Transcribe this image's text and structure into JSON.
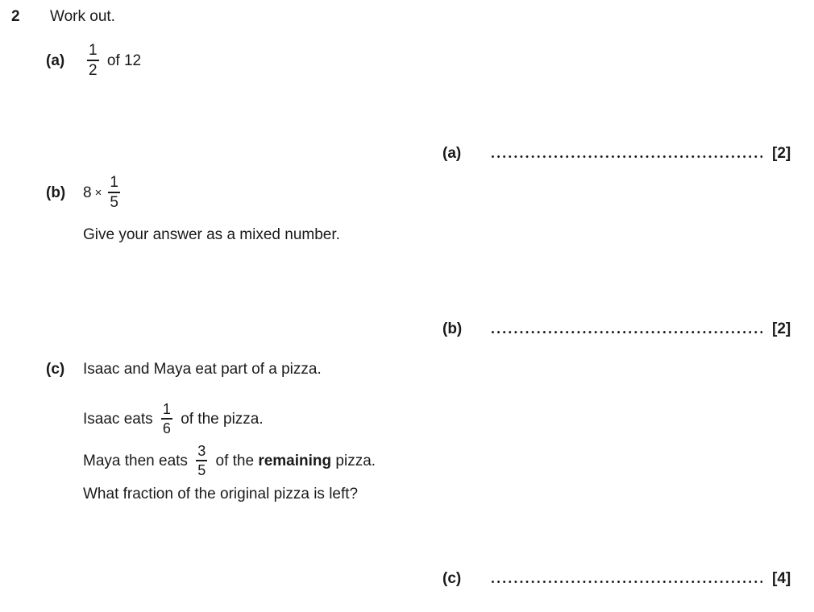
{
  "question": {
    "number": "2",
    "stem": "Work out."
  },
  "parts": {
    "a": {
      "label": "(a)",
      "fraction": {
        "numerator": "1",
        "denominator": "2"
      },
      "trailing_text": "of 12",
      "answer_label": "(a)",
      "marks": "[2]"
    },
    "b": {
      "label": "(b)",
      "leading_number": "8",
      "operator": "×",
      "fraction": {
        "numerator": "1",
        "denominator": "5"
      },
      "instruction": "Give your answer as a mixed number.",
      "answer_label": "(b)",
      "marks": "[2]"
    },
    "c": {
      "label": "(c)",
      "intro": "Isaac and Maya eat part of a pizza.",
      "line_isaac": {
        "before": "Isaac eats",
        "fraction": {
          "numerator": "1",
          "denominator": "6"
        },
        "after": "of the pizza."
      },
      "line_maya": {
        "before": "Maya then eats",
        "fraction": {
          "numerator": "3",
          "denominator": "5"
        },
        "after_plain_1": "of the",
        "after_bold": "remaining",
        "after_plain_2": "pizza."
      },
      "question_text": "What fraction of the original pizza is left?",
      "answer_label": "(c)",
      "marks": "[4]"
    }
  }
}
